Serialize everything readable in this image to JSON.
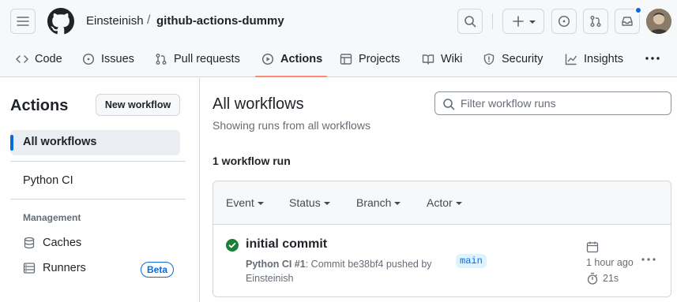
{
  "header": {
    "owner": "Einsteinish",
    "separator": "/",
    "repo": "github-actions-dummy",
    "notification_color": "#0969da"
  },
  "nav": {
    "tabs": [
      {
        "label": "Code",
        "icon": "code-icon"
      },
      {
        "label": "Issues",
        "icon": "issue-opened-icon"
      },
      {
        "label": "Pull requests",
        "icon": "git-pull-request-icon"
      },
      {
        "label": "Actions",
        "icon": "play-icon",
        "active": true
      },
      {
        "label": "Projects",
        "icon": "table-icon"
      },
      {
        "label": "Wiki",
        "icon": "book-icon"
      },
      {
        "label": "Security",
        "icon": "shield-icon"
      },
      {
        "label": "Insights",
        "icon": "graph-icon"
      }
    ],
    "active_color": "#fd8c73"
  },
  "sidebar": {
    "title": "Actions",
    "new_workflow_label": "New workflow",
    "all_workflows_label": "All workflows",
    "workflows": [
      "Python CI"
    ],
    "management_heading": "Management",
    "caches_label": "Caches",
    "runners_label": "Runners",
    "beta_label": "Beta"
  },
  "main": {
    "title": "All workflows",
    "subtitle": "Showing runs from all workflows",
    "filter_placeholder": "Filter workflow runs",
    "run_count": "1 workflow run",
    "filters": [
      "Event",
      "Status",
      "Branch",
      "Actor"
    ],
    "runs": [
      {
        "title": "initial commit",
        "workflow": "Python CI #1",
        "description": ": Commit be38bf4 pushed by",
        "author": "Einsteinish",
        "branch": "main",
        "time_ago": "1 hour ago",
        "duration": "21s",
        "status": "success",
        "status_color": "#1a7f37"
      }
    ]
  }
}
